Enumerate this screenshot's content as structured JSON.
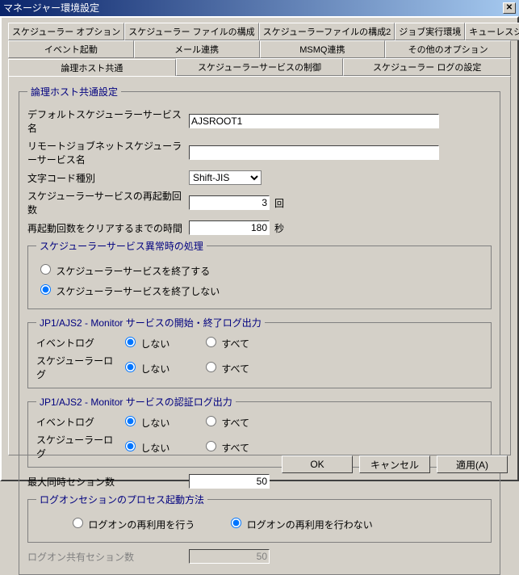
{
  "title": "マネージャー環境設定",
  "close_glyph": "✕",
  "tabs_row1": [
    "スケジューラー オプション",
    "スケジューラー ファイルの構成",
    "スケジューラーファイルの構成2",
    "ジョブ実行環境",
    "キューレスジョブ実行環境"
  ],
  "tabs_row2": [
    "イベント起動",
    "メール連携",
    "MSMQ連携",
    "その他のオプション"
  ],
  "tabs_row3": [
    "論理ホスト共通",
    "スケジューラーサービスの制御",
    "スケジューラー ログの設定"
  ],
  "active_tab": "論理ホスト共通",
  "group_main": "論理ホスト共通設定",
  "fields": {
    "default_service_label": "デフォルトスケジューラーサービス名",
    "default_service_value": "AJSROOT1",
    "remote_service_label": "リモートジョブネットスケジューラーサービス名",
    "remote_service_value": "",
    "charset_label": "文字コード種別",
    "charset_value": "Shift-JIS",
    "restart_count_label": "スケジューラーサービスの再起動回数",
    "restart_count_value": "3",
    "restart_count_unit": "回",
    "restart_clear_label": "再起動回数をクリアするまでの時間",
    "restart_clear_value": "180",
    "restart_clear_unit": "秒"
  },
  "group_abend": {
    "legend": "スケジューラーサービス異常時の処理",
    "opt_terminate": "スケジューラーサービスを終了する",
    "opt_not_terminate": "スケジューラーサービスを終了しない",
    "selected": "opt_not_terminate"
  },
  "group_startstop_log": {
    "legend": "JP1/AJS2 - Monitor サービスの開始・終了ログ出力",
    "row1_label": "イベントログ",
    "row2_label": "スケジューラーログ",
    "opt_no": "しない",
    "opt_all": "すべて",
    "row1_selected": "opt_no",
    "row2_selected": "opt_no"
  },
  "group_auth_log": {
    "legend": "JP1/AJS2 - Monitor サービスの認証ログ出力",
    "row1_label": "イベントログ",
    "row2_label": "スケジューラーログ",
    "opt_no": "しない",
    "opt_all": "すべて",
    "row1_selected": "opt_no",
    "row2_selected": "opt_no"
  },
  "max_sessions": {
    "label": "最大同時セション数",
    "value": "50"
  },
  "group_logon": {
    "legend": "ログオンセションのプロセス起動方法",
    "opt_reuse": "ログオンの再利用を行う",
    "opt_noreuse": "ログオンの再利用を行わない",
    "selected": "opt_noreuse"
  },
  "shared_sessions": {
    "label": "ログオン共有セション数",
    "value": "50"
  },
  "buttons": {
    "ok": "OK",
    "cancel": "キャンセル",
    "apply": "適用(A)"
  }
}
